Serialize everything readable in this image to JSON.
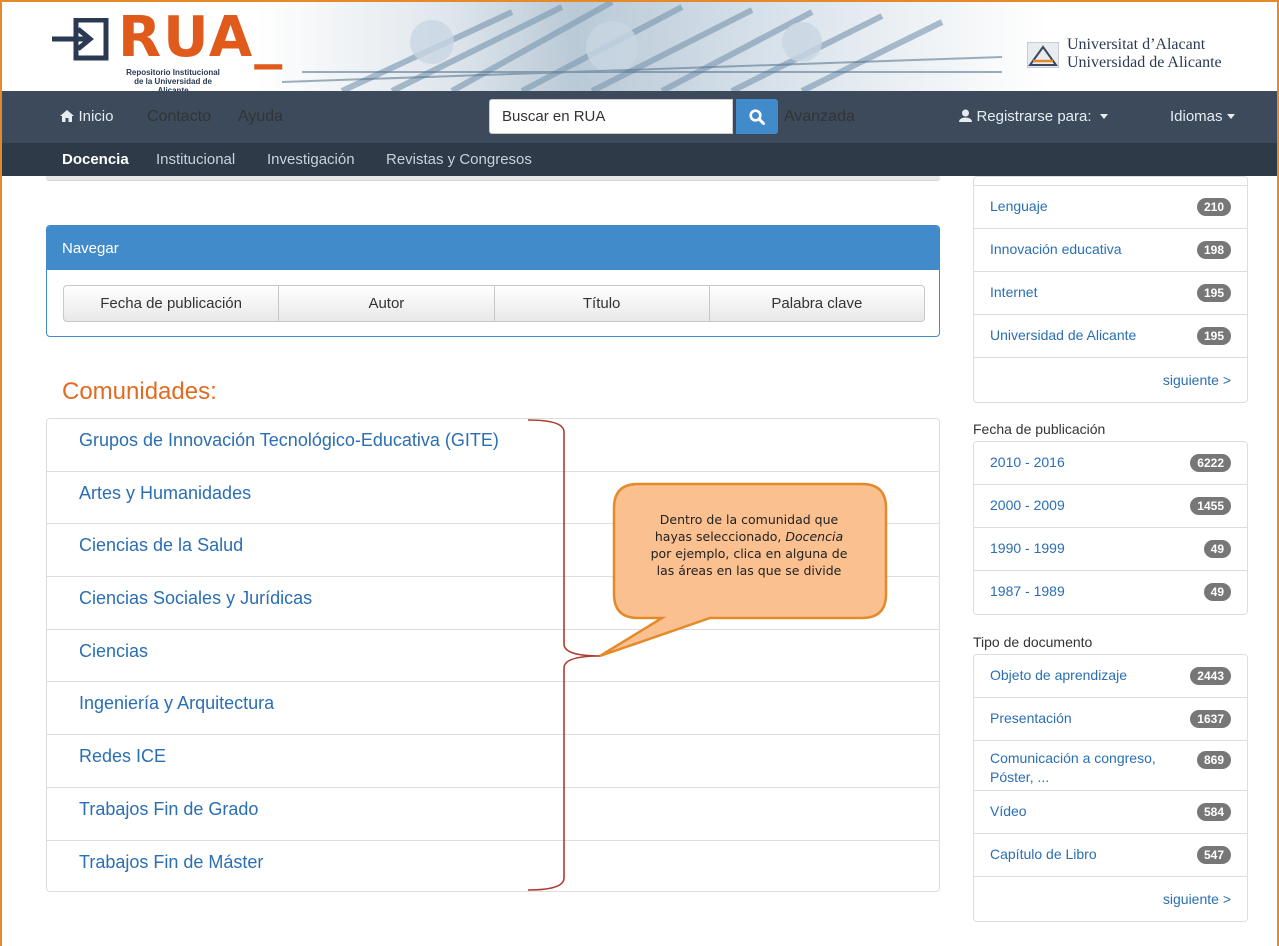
{
  "header": {
    "logo_text": "RUA_",
    "logo_subtitle_line1": "Repositorio Institucional",
    "logo_subtitle_line2": "de la Universidad de Alicante",
    "university_line1": "Universitat d’Alacant",
    "university_line2": "Universidad de Alicante"
  },
  "topnav": {
    "home": "Inicio",
    "contact": "Contacto",
    "help": "Ayuda",
    "search_value": "Buscar en RUA",
    "advanced": "Avanzada",
    "register": "Registrarse para:",
    "languages": "Idiomas"
  },
  "subnav": {
    "items": [
      "Docencia",
      "Institucional",
      "Investigación",
      "Revistas y Congresos"
    ]
  },
  "browse": {
    "heading": "Navegar",
    "buttons": [
      "Fecha de publicación",
      "Autor",
      "Título",
      "Palabra clave"
    ]
  },
  "communities": {
    "heading": "Comunidades:",
    "items": [
      "Grupos de Innovación Tecnológico-Educativa (GITE)",
      "Artes y Humanidades",
      "Ciencias de la Salud",
      "Ciencias Sociales y Jurídicas",
      "Ciencias",
      "Ingeniería y Arquitectura",
      "Redes ICE",
      "Trabajos Fin de Grado",
      "Trabajos Fin de Máster"
    ]
  },
  "callout": {
    "line1": "Dentro de la comunidad que",
    "line2a": "hayas seleccionado, ",
    "line2b": "Docencia",
    "line3": "por ejemplo,  clica en alguna de",
    "line4": "las áreas en las que se divide"
  },
  "sidebar": {
    "subjects": [
      {
        "label": "Lenguaje",
        "count": "210"
      },
      {
        "label": "Innovación educativa",
        "count": "198"
      },
      {
        "label": "Internet",
        "count": "195"
      },
      {
        "label": "Universidad de Alicante",
        "count": "195"
      }
    ],
    "next": "siguiente >",
    "date_title": "Fecha de publicación",
    "dates": [
      {
        "label": "2010 - 2016",
        "count": "6222"
      },
      {
        "label": "2000 - 2009",
        "count": "1455"
      },
      {
        "label": "1990 - 1999",
        "count": "49"
      },
      {
        "label": "1987 - 1989",
        "count": "49"
      }
    ],
    "type_title": "Tipo de documento",
    "types": [
      {
        "label": "Objeto de aprendizaje",
        "count": "2443"
      },
      {
        "label": "Presentación",
        "count": "1637"
      },
      {
        "label": "Comunicación a congreso, Póster, ...",
        "count": "869"
      },
      {
        "label": "Vídeo",
        "count": "584"
      },
      {
        "label": "Capítulo de Libro",
        "count": "547"
      }
    ]
  },
  "colors": {
    "accent_orange": "#e36a22",
    "nav_dark": "#3c4a5b",
    "link_blue": "#2a6eb3",
    "panel_blue": "#428bca"
  }
}
